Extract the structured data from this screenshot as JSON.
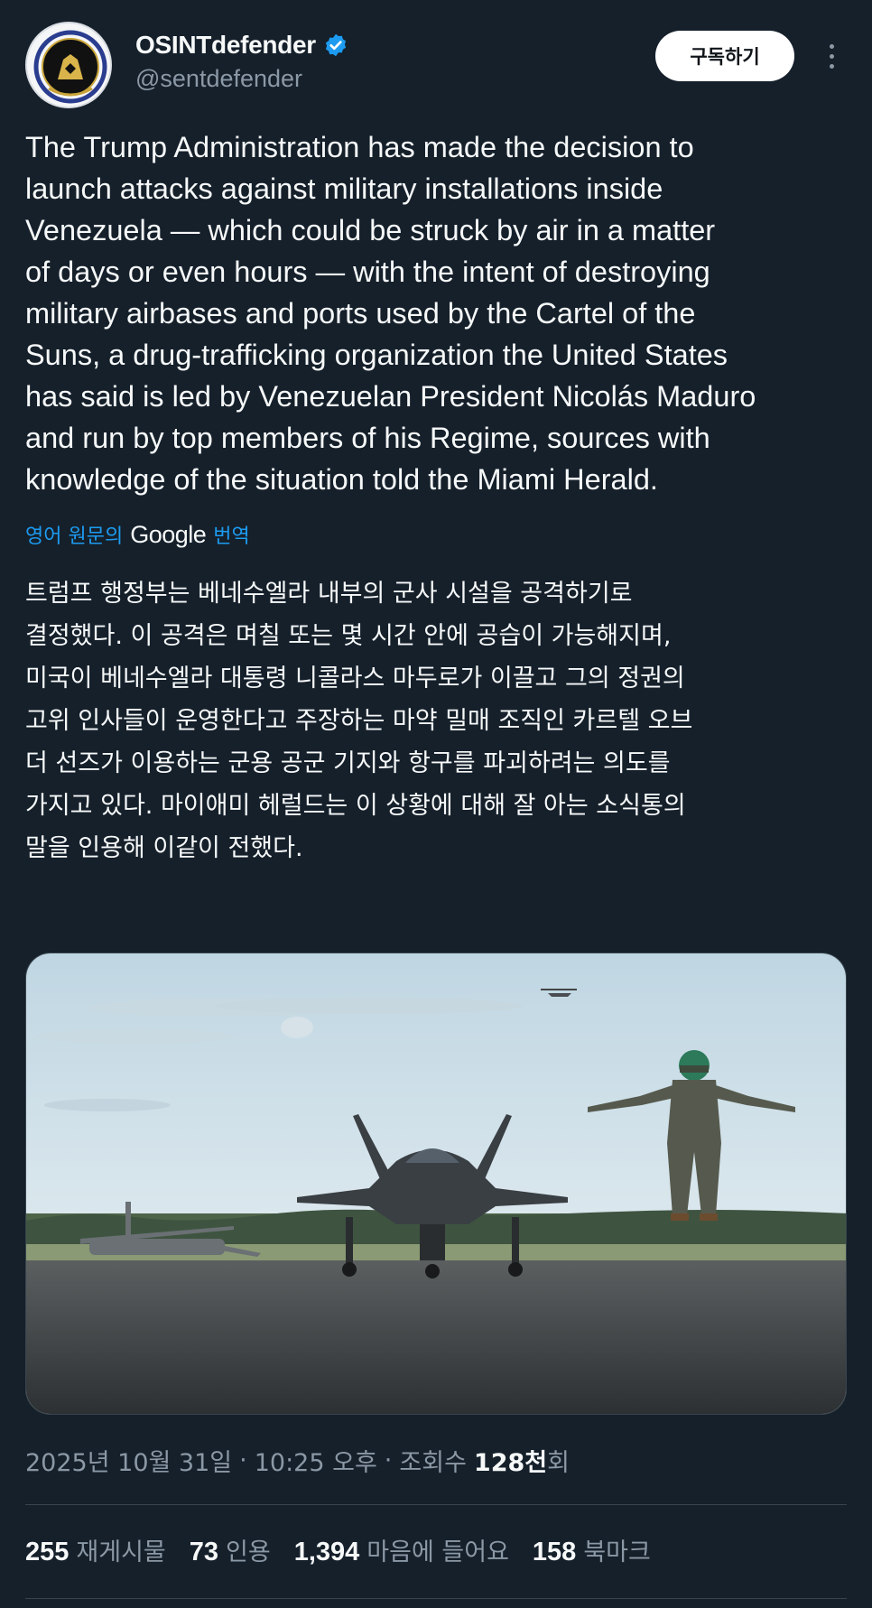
{
  "author": {
    "display_name": "OSINTdefender",
    "handle": "@sentdefender",
    "verified_icon": "verified-badge-icon"
  },
  "header": {
    "subscribe_label": "구독하기",
    "more_icon": "more-vertical-icon"
  },
  "tweet": {
    "text": "The Trump Administration has made the decision to\nlaunch attacks against military installations inside\nVenezuela — which could be struck by air in a matter\nof days or even hours — with the intent of destroying\nmilitary airbases and ports used by the Cartel of the\nSuns, a drug-trafficking organization the United States\nhas said is led by Venezuelan President Nicolás Maduro\nand run by top members of his Regime, sources with\nknowledge of the situation told the Miami Herald.",
    "translation_prefix": "영어 원문의",
    "translation_brand": "Google",
    "translation_suffix": "번역",
    "translated_text": "트럼프 행정부는 베네수엘라 내부의 군사 시설을 공격하기로\n결정했다. 이 공격은 며칠 또는 몇 시간 안에 공습이 가능해지며,\n미국이 베네수엘라 대통령 니콜라스 마두로가 이끌고 그의 정권의\n고위 인사들이 운영한다고 주장하는 마약 밀매 조직인 카르텔 오브\n더 선즈가 이용하는 군용 공군 기지와 항구를 파괴하려는 의도를\n가지고 있다. 마이애미 헤럴드는 이 상황에 대해 잘 아는 소식통의\n말을 인용해 이같이 전했다."
  },
  "meta": {
    "date": "2025년 10월 31일",
    "sep1": "·",
    "time": "10:25 오후",
    "sep2": "·",
    "views_label": "조회수",
    "views_value": "128천",
    "views_suffix": "회"
  },
  "stats": [
    {
      "value": "255",
      "label": "재게시물"
    },
    {
      "value": "73",
      "label": "인용"
    },
    {
      "value": "1,394",
      "label": "마음에 들어요"
    },
    {
      "value": "158",
      "label": "북마크"
    }
  ],
  "colors": {
    "background": "#15202b",
    "accent": "#1d9bf0",
    "secondary_text": "#8b98a5"
  }
}
